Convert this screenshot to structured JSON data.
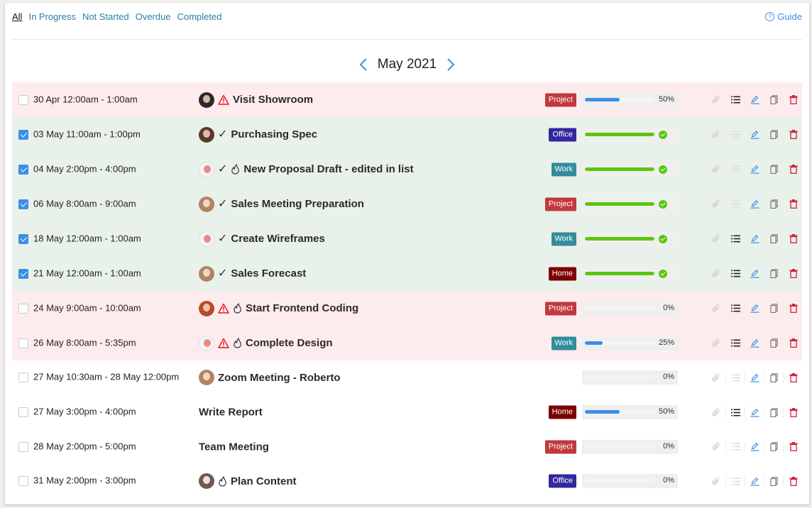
{
  "filters": {
    "items": [
      {
        "label": "All",
        "active": true
      },
      {
        "label": "In Progress",
        "active": false
      },
      {
        "label": "Not Started",
        "active": false
      },
      {
        "label": "Overdue",
        "active": false
      },
      {
        "label": "Completed",
        "active": false
      }
    ]
  },
  "guide": {
    "label": "Guide",
    "icon": "question-circle-icon"
  },
  "month_nav": {
    "label": "May 2021",
    "prev_icon": "chevron-left-icon",
    "next_icon": "chevron-right-icon"
  },
  "colors": {
    "accent": "#3b8fe6",
    "overdue_bg": "#fdecee",
    "completed_bg": "#e9f2ea",
    "progress_blue": "#3b8fe6",
    "progress_green": "#5ac70f",
    "tag_project": "#c1393f",
    "tag_office": "#32279f",
    "tag_work": "#328c9b",
    "tag_home": "#7d0000"
  },
  "tasks": [
    {
      "date": "30 Apr 12:00am - 1:00am",
      "checked": false,
      "status": "overdue",
      "avatar": "av-dark",
      "warning": true,
      "done_mark": false,
      "fire": false,
      "title": "Visit Showroom",
      "tag": "Project",
      "tag_color": "#c1393f",
      "progress": 50,
      "progress_label": "50%",
      "has_subtasks": true
    },
    {
      "date": "03 May 11:00am - 1:00pm",
      "checked": true,
      "status": "done",
      "avatar": "av-beard",
      "warning": false,
      "done_mark": true,
      "fire": false,
      "title": "Purchasing Spec",
      "tag": "Office",
      "tag_color": "#32279f",
      "progress": 100,
      "progress_label": "",
      "has_subtasks": false
    },
    {
      "date": "04 May 2:00pm - 4:00pm",
      "checked": true,
      "status": "done",
      "avatar": "av-mime",
      "warning": false,
      "done_mark": true,
      "fire": true,
      "title": "New Proposal Draft - edited in list",
      "tag": "Work",
      "tag_color": "#328c9b",
      "progress": 100,
      "progress_label": "",
      "has_subtasks": false
    },
    {
      "date": "06 May 8:00am - 9:00am",
      "checked": true,
      "status": "done",
      "avatar": "av-woman",
      "warning": false,
      "done_mark": true,
      "fire": false,
      "title": "Sales Meeting Preparation",
      "tag": "Project",
      "tag_color": "#c1393f",
      "progress": 100,
      "progress_label": "",
      "has_subtasks": false
    },
    {
      "date": "18 May 12:00am - 1:00am",
      "checked": true,
      "status": "done",
      "avatar": "av-mime",
      "warning": false,
      "done_mark": true,
      "fire": false,
      "title": "Create Wireframes",
      "tag": "Work",
      "tag_color": "#328c9b",
      "progress": 100,
      "progress_label": "",
      "has_subtasks": true
    },
    {
      "date": "21 May 12:00am - 1:00am",
      "checked": true,
      "status": "done",
      "avatar": "av-woman",
      "warning": false,
      "done_mark": true,
      "fire": false,
      "title": "Sales Forecast",
      "tag": "Home",
      "tag_color": "#7d0000",
      "progress": 100,
      "progress_label": "",
      "has_subtasks": true
    },
    {
      "date": "24 May 9:00am - 10:00am",
      "checked": false,
      "status": "overdue",
      "avatar": "av-red",
      "warning": true,
      "done_mark": false,
      "fire": true,
      "title": "Start Frontend Coding",
      "tag": "Project",
      "tag_color": "#c1393f",
      "progress": 0,
      "progress_label": "0%",
      "has_subtasks": true
    },
    {
      "date": "26 May 8:00am - 5:35pm",
      "checked": false,
      "status": "overdue",
      "avatar": "av-mime",
      "warning": true,
      "done_mark": false,
      "fire": true,
      "title": "Complete Design",
      "tag": "Work",
      "tag_color": "#328c9b",
      "progress": 25,
      "progress_label": "25%",
      "has_subtasks": true
    },
    {
      "date": "27 May 10:30am - 28 May 12:00pm",
      "checked": false,
      "status": "normal",
      "avatar": "av-woman",
      "warning": false,
      "done_mark": false,
      "fire": false,
      "title": "Zoom Meeting - Roberto",
      "tag": "",
      "tag_color": "",
      "progress": 0,
      "progress_label": "0%",
      "has_subtasks": false
    },
    {
      "date": "27 May 3:00pm - 4:00pm",
      "checked": false,
      "status": "normal",
      "avatar": "",
      "warning": false,
      "done_mark": false,
      "fire": false,
      "title": "Write Report",
      "tag": "Home",
      "tag_color": "#7d0000",
      "progress": 50,
      "progress_label": "50%",
      "has_subtasks": true
    },
    {
      "date": "28 May 2:00pm - 5:00pm",
      "checked": false,
      "status": "normal",
      "avatar": "",
      "warning": false,
      "done_mark": false,
      "fire": false,
      "title": "Team Meeting",
      "tag": "Project",
      "tag_color": "#c1393f",
      "progress": 0,
      "progress_label": "0%",
      "has_subtasks": false
    },
    {
      "date": "31 May 2:00pm - 3:00pm",
      "checked": false,
      "status": "normal",
      "avatar": "av-content",
      "warning": false,
      "done_mark": false,
      "fire": true,
      "title": "Plan Content",
      "tag": "Office",
      "tag_color": "#32279f",
      "progress": 0,
      "progress_label": "0%",
      "has_subtasks": false
    }
  ],
  "actions": [
    {
      "name": "attachment",
      "icon": "paperclip-icon"
    },
    {
      "name": "subtasks",
      "icon": "list-icon"
    },
    {
      "name": "edit",
      "icon": "pencil-icon"
    },
    {
      "name": "duplicate",
      "icon": "copy-icon"
    },
    {
      "name": "delete",
      "icon": "trash-icon"
    }
  ]
}
